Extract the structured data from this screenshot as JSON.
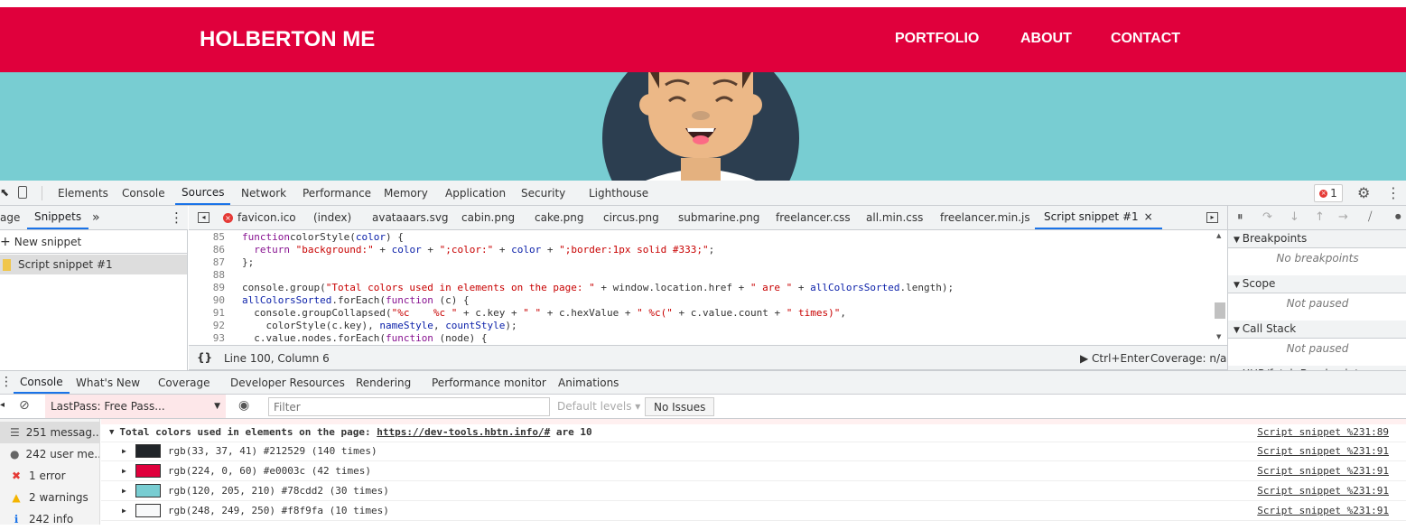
{
  "site": {
    "brand": "HOLBERTON ME",
    "nav": [
      "PORTFOLIO",
      "ABOUT",
      "CONTACT"
    ],
    "colors": {
      "header": "#e0003c",
      "hero": "#78cdd2"
    }
  },
  "devtools": {
    "main_tabs": [
      "Elements",
      "Console",
      "Sources",
      "Network",
      "Performance",
      "Memory",
      "Application",
      "Security",
      "Lighthouse"
    ],
    "active_main_tab": "Sources",
    "error_badge": "1",
    "nav_tabs": [
      "age",
      "Snippets"
    ],
    "new_snippet": "New snippet",
    "snippet": "Script snippet #1",
    "file_tabs": [
      "favicon.ico",
      "(index)",
      "avataaars.svg",
      "cabin.png",
      "cake.png",
      "circus.png",
      "submarine.png",
      "freelancer.css",
      "all.min.css",
      "freelancer.min.js",
      "Script snippet #1"
    ],
    "code": [
      {
        "n": "85",
        "t": [
          [
            "kw",
            "function"
          ],
          [
            "",
            "colorStyle("
          ],
          [
            "var",
            "color"
          ],
          [
            "",
            ") {"
          ]
        ]
      },
      {
        "n": "86",
        "t": [
          [
            "",
            "  "
          ],
          [
            "kw",
            "return"
          ],
          [
            "str",
            " \"background:\""
          ],
          [
            "",
            " + "
          ],
          [
            "var",
            "color"
          ],
          [
            "",
            " + "
          ],
          [
            "str",
            "\";color:\""
          ],
          [
            "",
            " + "
          ],
          [
            "var",
            "color"
          ],
          [
            "",
            " + "
          ],
          [
            "str",
            "\";border:1px solid #333;\""
          ],
          [
            "",
            ";"
          ]
        ]
      },
      {
        "n": "87",
        "t": [
          [
            "",
            "};"
          ]
        ]
      },
      {
        "n": "88",
        "t": []
      },
      {
        "n": "89",
        "t": [
          [
            "",
            "console.group("
          ],
          [
            "str",
            "\"Total colors used in elements on the page: \""
          ],
          [
            "",
            " + window.location.href + "
          ],
          [
            "str",
            "\" are \""
          ],
          [
            "",
            " + "
          ],
          [
            "var",
            "allColorsSorted"
          ],
          [
            "",
            ".length);"
          ]
        ]
      },
      {
        "n": "90",
        "t": [
          [
            "var",
            "allColorsSorted"
          ],
          [
            "",
            ".forEach("
          ],
          [
            "kw",
            "function"
          ],
          [
            "",
            " (c) {"
          ]
        ]
      },
      {
        "n": "91",
        "t": [
          [
            "",
            "  console.groupCollapsed("
          ],
          [
            "str",
            "\"%c    %c \""
          ],
          [
            "",
            " + c.key + "
          ],
          [
            "str",
            "\" \""
          ],
          [
            "",
            " + c.hexValue + "
          ],
          [
            "str",
            "\" %c(\""
          ],
          [
            "",
            " + c.value.count + "
          ],
          [
            "str",
            "\" times)\""
          ],
          [
            "",
            ","
          ]
        ]
      },
      {
        "n": "92",
        "t": [
          [
            "",
            "    colorStyle(c.key), "
          ],
          [
            "var",
            "nameStyle"
          ],
          [
            "",
            ", "
          ],
          [
            "var",
            "countStyle"
          ],
          [
            "",
            ");"
          ]
        ]
      },
      {
        "n": "93",
        "t": [
          [
            "",
            "  c.value.nodes.forEach("
          ],
          [
            "kw",
            "function"
          ],
          [
            "",
            " (node) {"
          ]
        ]
      }
    ],
    "status": {
      "position": "Line 100, Column 6",
      "run": "Ctrl+Enter",
      "coverage": "Coverage: n/a"
    },
    "debugger": {
      "sections": [
        {
          "title": "Breakpoints",
          "body": "No breakpoints"
        },
        {
          "title": "Scope",
          "body": "Not paused"
        },
        {
          "title": "Call Stack",
          "body": "Not paused"
        },
        {
          "title": "XHR/fetch Breakpoints",
          "body": ""
        }
      ]
    },
    "drawer_tabs": [
      "Console",
      "What's New",
      "Coverage",
      "Developer Resources",
      "Rendering",
      "Performance monitor",
      "Animations"
    ],
    "console": {
      "context": "LastPass: Free Pass...",
      "filter_placeholder": "Filter",
      "levels": "Default levels",
      "issues": "No Issues",
      "sidebar": [
        {
          "icon": "list-icon",
          "label": "251 messag..."
        },
        {
          "icon": "user-icon",
          "label": "242 user me..."
        },
        {
          "icon": "error-icon",
          "label": "1 error"
        },
        {
          "icon": "warning-icon",
          "label": "2 warnings"
        },
        {
          "icon": "info-icon",
          "label": "242 info"
        }
      ],
      "group": {
        "prefix": "Total colors used in elements on the page: ",
        "url": "https://dev-tools.hbtn.info/#",
        "suffix": " are 10",
        "source": "Script snippet %231:89"
      },
      "rows": [
        {
          "color": "#212529",
          "text": "rgb(33, 37, 41) #212529 (140 times)",
          "source": "Script snippet %231:91"
        },
        {
          "color": "#e0003c",
          "text": "rgb(224, 0, 60) #e0003c (42 times)",
          "source": "Script snippet %231:91"
        },
        {
          "color": "#78cdd2",
          "text": "rgb(120, 205, 210) #78cdd2 (30 times)",
          "source": "Script snippet %231:91"
        },
        {
          "color": "#f8f9fa",
          "text": "rgb(248, 249, 250) #f8f9fa (10 times)",
          "source": "Script snippet %231:91"
        }
      ]
    }
  }
}
